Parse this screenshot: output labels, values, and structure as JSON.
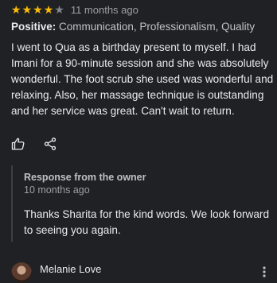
{
  "review": {
    "rating": 4,
    "max_rating": 5,
    "time": "11 months ago",
    "positive_label": "Positive:",
    "positive_items": "Communication, Professionalism, Quality",
    "text": "I went to Qua as a birthday present to myself. I had Imani for a 90-minute session and she was absolutely wonderful. The foot scrub she used was wonderful and relaxing. Also, her massage technique is outstanding and her service was great. Can't wait to return.",
    "actions": {
      "like_icon": "thumbs-up-icon",
      "share_icon": "share-icon"
    }
  },
  "response": {
    "title": "Response from the owner",
    "time": "10 months ago",
    "text": "Thanks Sharita for the kind words. We look forward to seeing you again."
  },
  "next_reviewer": {
    "name": "Melanie Love",
    "more_icon": "more-vert-icon"
  },
  "colors": {
    "background": "#202124",
    "star": "#fbbc04",
    "text": "#e8eaed",
    "muted": "#9aa0a6"
  }
}
